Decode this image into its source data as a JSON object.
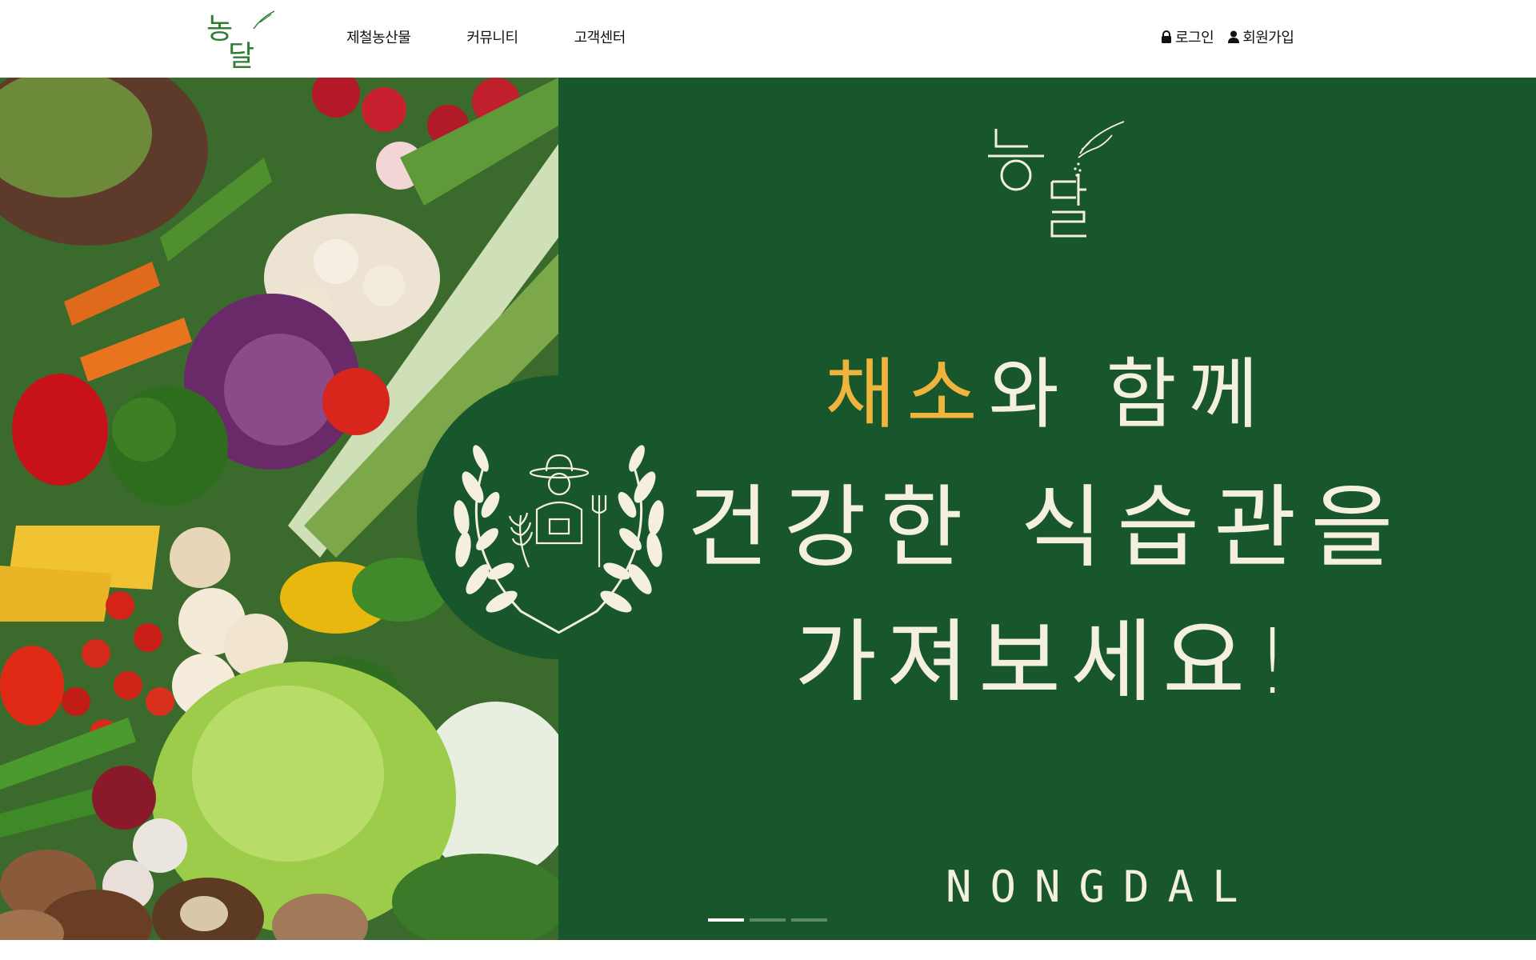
{
  "header": {
    "nav": [
      "제철농산물",
      "커뮤니티",
      "고객센터"
    ],
    "login_label": "로그인",
    "signup_label": "회원가입"
  },
  "hero": {
    "headline_highlight": "채소",
    "headline_rest": "와 함께",
    "line2": "건강한 식습관을",
    "line3": "가져보세요!",
    "brand": "NONGDAL",
    "logo_text_top": "농",
    "logo_text_bottom": "달",
    "slider": {
      "total": 3,
      "active": 1
    }
  },
  "colors": {
    "green": "#17572b",
    "accent": "#f0b43c",
    "cream": "#f5efe0"
  },
  "icons": [
    "lock-icon",
    "user-icon",
    "laurel-farmer-emblem",
    "hand-sprinkle-icon"
  ]
}
